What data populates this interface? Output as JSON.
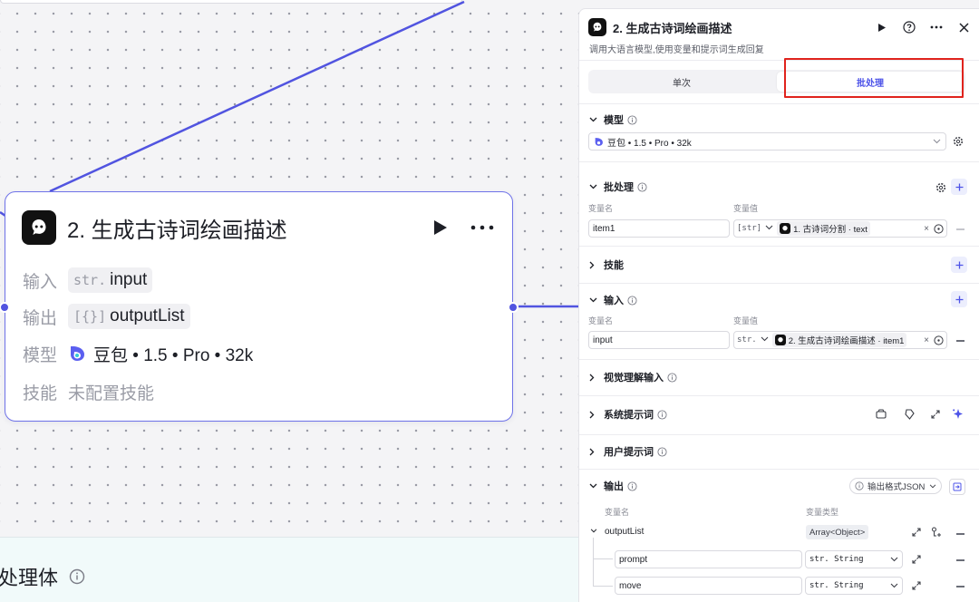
{
  "node": {
    "title": "2. 生成古诗词绘画描述",
    "input_label": "输入",
    "input_type": "str.",
    "input_value": "input",
    "output_label": "输出",
    "output_type": "[{}]",
    "output_value": "outputList",
    "model_label": "模型",
    "model_value": "豆包 • 1.5 • Pro • 32k",
    "skills_label": "技能",
    "skills_value": "未配置技能"
  },
  "bottom_node": {
    "title": "处理体"
  },
  "panel": {
    "title": "2. 生成古诗词绘画描述",
    "subtitle": "调用大语言模型,使用变量和提示词生成回复",
    "tabs": [
      {
        "label": "单次",
        "active": false
      },
      {
        "label": "批处理",
        "active": true
      }
    ],
    "model": {
      "label": "模型",
      "value": "豆包 • 1.5 • Pro • 32k"
    },
    "batch": {
      "label": "批处理",
      "col_name": "变量名",
      "col_value": "变量值",
      "row": {
        "name": "item1",
        "type": "[str]",
        "ref": "1. 古诗词分割 · text"
      }
    },
    "skills": {
      "label": "技能"
    },
    "inputs": {
      "label": "输入",
      "col_name": "变量名",
      "col_value": "变量值",
      "row": {
        "name": "input",
        "type": "str.",
        "ref": "2. 生成古诗词绘画描述 · item1"
      }
    },
    "vision": {
      "label": "视觉理解输入"
    },
    "system_prompt": {
      "label": "系统提示词"
    },
    "user_prompt": {
      "label": "用户提示词"
    },
    "output": {
      "label": "输出",
      "format_label": "输出格式JSON",
      "col_name": "变量名",
      "col_type": "变量类型",
      "root": {
        "name": "outputList",
        "type": "Array<Object>"
      },
      "children": [
        {
          "name": "prompt",
          "type": "str. String"
        },
        {
          "name": "move",
          "type": "str. String"
        }
      ]
    }
  },
  "colors": {
    "accent": "#4d53e8",
    "edge": "#5154e0",
    "highlight": "#e0231d"
  }
}
